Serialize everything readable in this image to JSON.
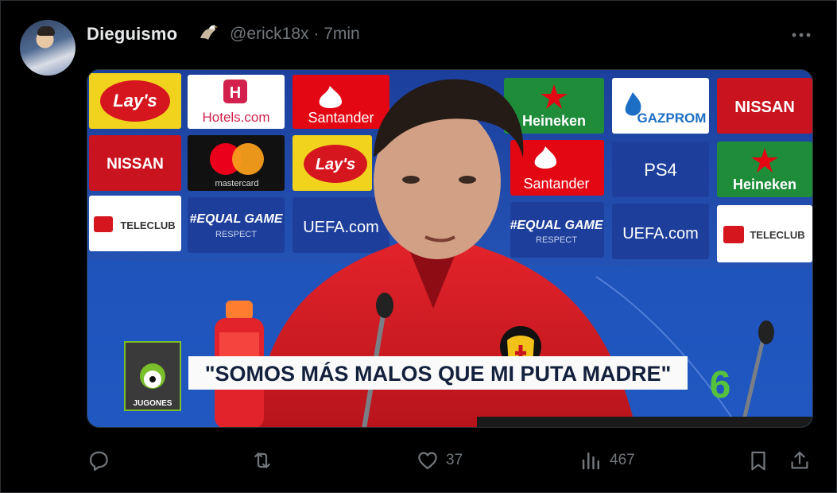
{
  "tweet": {
    "author_name": "Dieguismo",
    "handle": "@erick18x",
    "separator": "·",
    "time": "7min",
    "badge_icon": "eagle-emoji"
  },
  "media": {
    "caption": "\"SOMOS MÁS MALOS QUE MI PUTA MADRE\"",
    "corner_logo_text": "JUGONES",
    "channel_logo": "6",
    "sponsors": [
      "Lay's",
      "Hotels.com",
      "Santander",
      "Heineken",
      "GAZPROM",
      "NISSAN",
      "mastercard",
      "PS4",
      "#EQUAL GAME",
      "RESPECT",
      "UEFA.com",
      "TELECLUB"
    ]
  },
  "actions": {
    "reply_icon": "reply-icon",
    "retweet_icon": "retweet-icon",
    "like_icon": "heart-icon",
    "like_count": "37",
    "views_icon": "views-icon",
    "views_count": "467",
    "bookmark_icon": "bookmark-icon",
    "share_icon": "share-icon"
  },
  "colors": {
    "background": "#000000",
    "text_primary": "#e7e9ea",
    "text_secondary": "#71767b",
    "border": "#2f3336"
  }
}
